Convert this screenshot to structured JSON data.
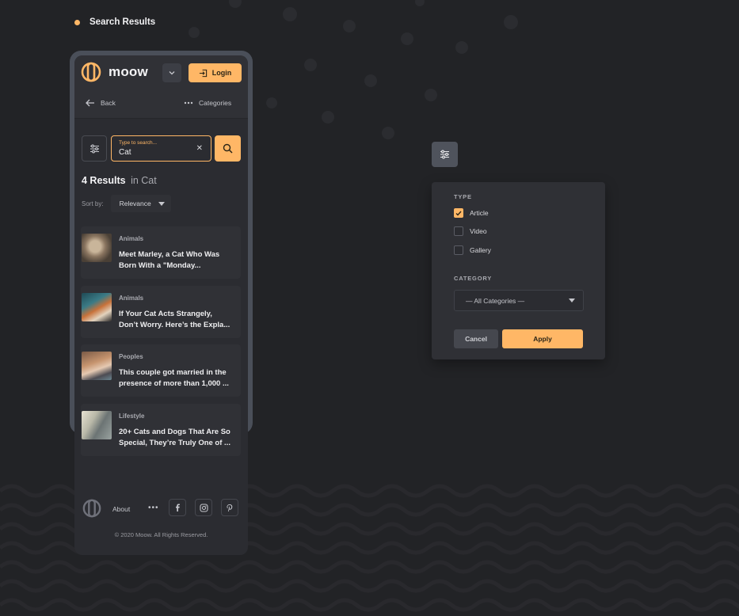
{
  "page": {
    "label": "Search Results",
    "accent_color": "#ffb766"
  },
  "header": {
    "brand": "moow",
    "login_label": "Login",
    "back_label": "Back",
    "categories_label": "Categories"
  },
  "search": {
    "placeholder": "Type to search...",
    "value": "Cat"
  },
  "results": {
    "count_label": "4 Results",
    "scope_label": "in Cat",
    "sort_label": "Sort by:",
    "sort_value": "Relevance",
    "items": [
      {
        "category": "Animals",
        "title": "Meet Marley, a Cat Who Was\nBorn With a \"Monday...",
        "thumb_icon": "cat-photo"
      },
      {
        "category": "Animals",
        "title": "If Your Cat Acts Strangely,\nDon’t Worry. Here’s the Expla...",
        "thumb_icon": "cat-photo"
      },
      {
        "category": "Peoples",
        "title": "This couple got married in the\npresence of more than 1,000 ...",
        "thumb_icon": "people-photo"
      },
      {
        "category": "Lifestyle",
        "title": "20+ Cats and Dogs That Are So\nSpecial, They’re Truly One of ...",
        "thumb_icon": "cat-photo"
      }
    ]
  },
  "footer": {
    "about_label": "About",
    "copyright": "© 2020 Moow. All Rights Reserved.",
    "social_icons": [
      "facebook-icon",
      "instagram-icon",
      "pinterest-icon"
    ]
  },
  "filter_panel": {
    "type_label": "TYPE",
    "types": [
      {
        "label": "Article",
        "checked": true
      },
      {
        "label": "Video",
        "checked": false
      },
      {
        "label": "Gallery",
        "checked": false
      }
    ],
    "category_label": "CATEGORY",
    "category_value": "— All Categories —",
    "cancel_label": "Cancel",
    "apply_label": "Apply"
  }
}
